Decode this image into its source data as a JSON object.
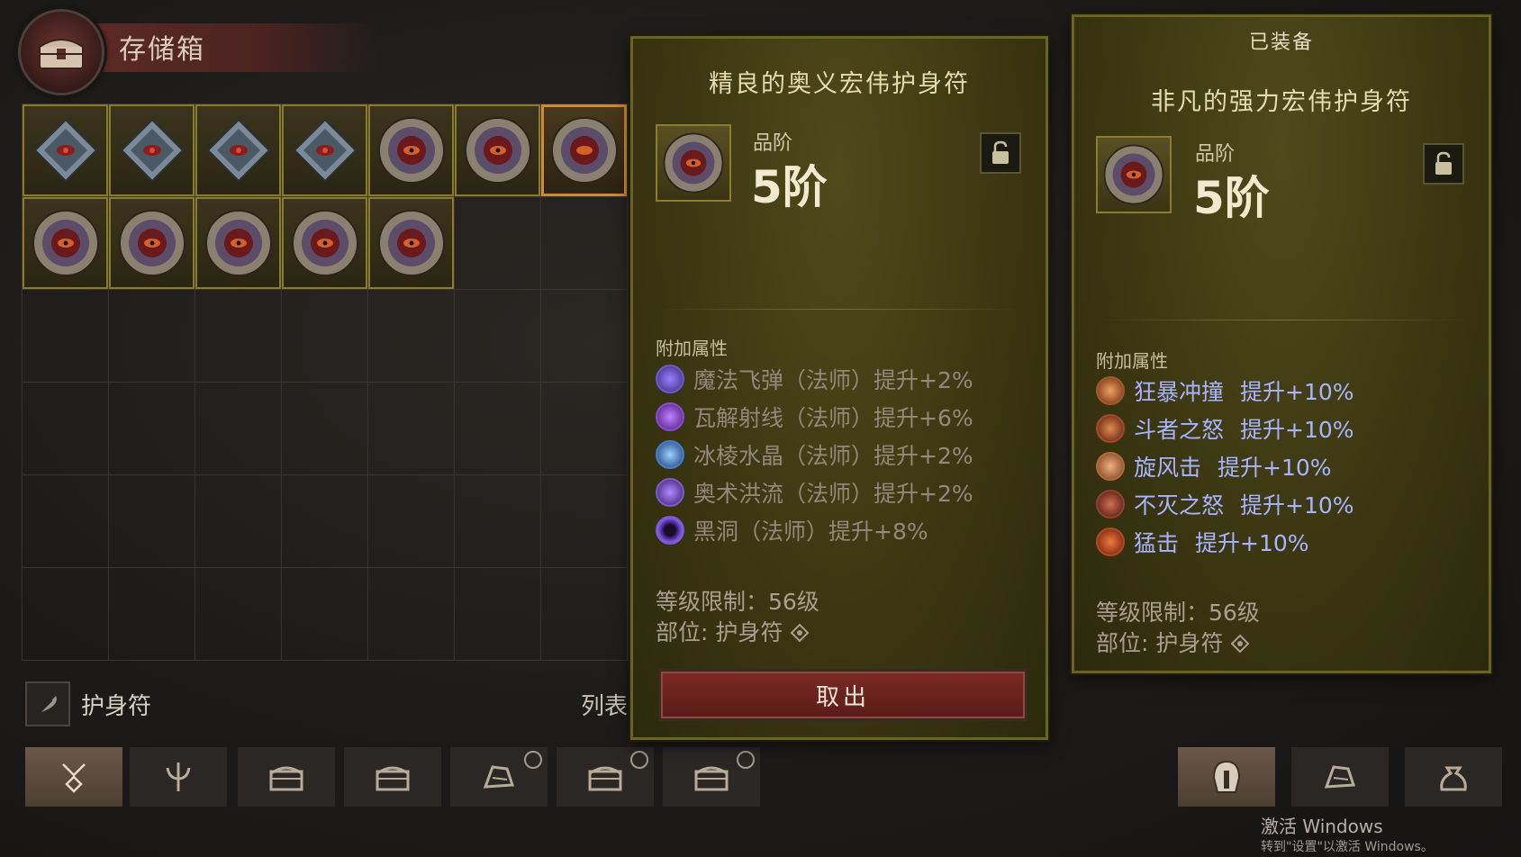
{
  "stash": {
    "title": "存储箱",
    "filter_label": "护身符",
    "list_label": "列表"
  },
  "left_tooltip": {
    "name": "精良的奥义宏伟护身符",
    "grade_label": "品阶",
    "grade_value": "5阶",
    "section_label": "附加属性",
    "affixes": [
      {
        "name": "魔法飞弹（法师）",
        "bonus": "提升+2%",
        "icon": "magic-missile-icon"
      },
      {
        "name": "瓦解射线（法师）",
        "bonus": "提升+6%",
        "icon": "disintegrate-icon"
      },
      {
        "name": "冰棱水晶（法师）",
        "bonus": "提升+2%",
        "icon": "ice-crystal-icon"
      },
      {
        "name": "奥术洪流（法师）",
        "bonus": "提升+2%",
        "icon": "arcane-torrent-icon"
      },
      {
        "name": "黑洞（法师）",
        "bonus": "提升+8%",
        "icon": "black-hole-icon"
      }
    ],
    "level_req": "等级限制：56级",
    "slot": "部位: 护身符",
    "take_out_button": "取出"
  },
  "right_tooltip": {
    "equipped_label": "已装备",
    "name": "非凡的强力宏伟护身符",
    "grade_label": "品阶",
    "grade_value": "5阶",
    "section_label": "附加属性",
    "affixes": [
      {
        "name": "狂暴冲撞",
        "bonus": "提升+10%",
        "icon": "furious-charge-icon"
      },
      {
        "name": "斗者之怒",
        "bonus": "提升+10%",
        "icon": "wrath-of-berserker-icon"
      },
      {
        "name": "旋风击",
        "bonus": "提升+10%",
        "icon": "whirlwind-icon"
      },
      {
        "name": "不灭之怒",
        "bonus": "提升+10%",
        "icon": "undying-rage-icon"
      },
      {
        "name": "猛击",
        "bonus": "提升+10%",
        "icon": "hammer-strike-icon"
      }
    ],
    "level_req": "等级限制：56级",
    "slot": "部位: 护身符"
  },
  "watermark": {
    "line1": "激活 Windows",
    "line2": "转到\"设置\"以激活 Windows。"
  },
  "colors": {
    "tooltip_bg": "#3b3712",
    "affix_dim": "#8f8a7a",
    "affix_bright": "#a9b4ff",
    "take_button": "#6a221c"
  }
}
